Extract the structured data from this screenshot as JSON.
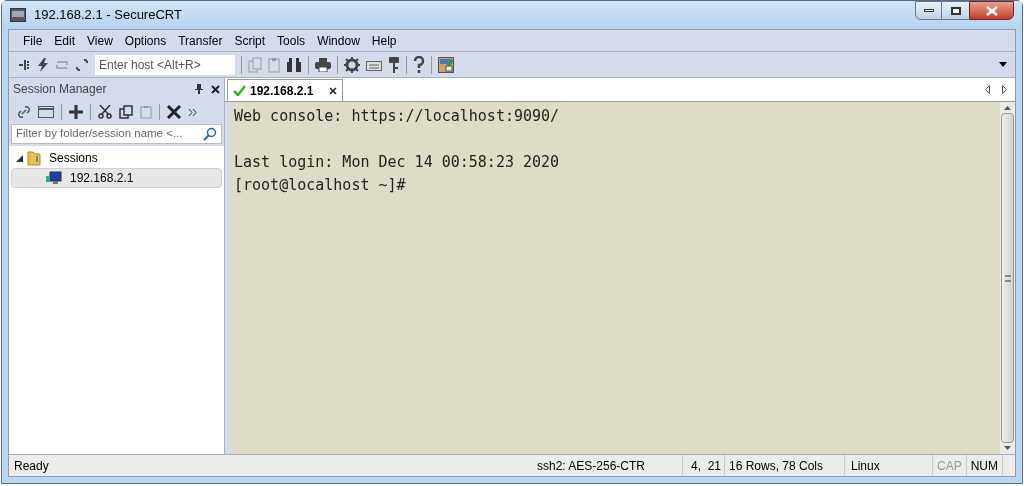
{
  "window": {
    "title": "192.168.2.1 - SecureCRT"
  },
  "menu": [
    "File",
    "Edit",
    "View",
    "Options",
    "Transfer",
    "Script",
    "Tools",
    "Window",
    "Help"
  ],
  "toolbar": {
    "host_field": {
      "placeholder": "Enter host <Alt+R>"
    }
  },
  "session_manager": {
    "title": "Session Manager",
    "filter": {
      "placeholder": "Filter by folder/session name <..."
    },
    "tree": [
      {
        "label": "Sessions",
        "expanded": true,
        "selected": false,
        "children": [
          {
            "label": "192.168.2.1",
            "selected": true
          }
        ]
      }
    ]
  },
  "tabs": [
    {
      "label": "192.168.2.1",
      "connected": true,
      "selected": true
    }
  ],
  "terminal": {
    "blocks": [
      [
        "Web console: https://localhost:9090/"
      ],
      [
        "Last login: Mon Dec 14 00:58:23 2020",
        "[root@localhost ~]#"
      ]
    ]
  },
  "status_bar": {
    "message": "Ready",
    "cipher": "ssh2: AES-256-CTR",
    "cursor": "4,  21",
    "size": "16 Rows, 78 Cols",
    "os": "Linux",
    "indicators": [
      {
        "label": "CAP",
        "on": false
      },
      {
        "label": "NUM",
        "on": true
      }
    ]
  }
}
